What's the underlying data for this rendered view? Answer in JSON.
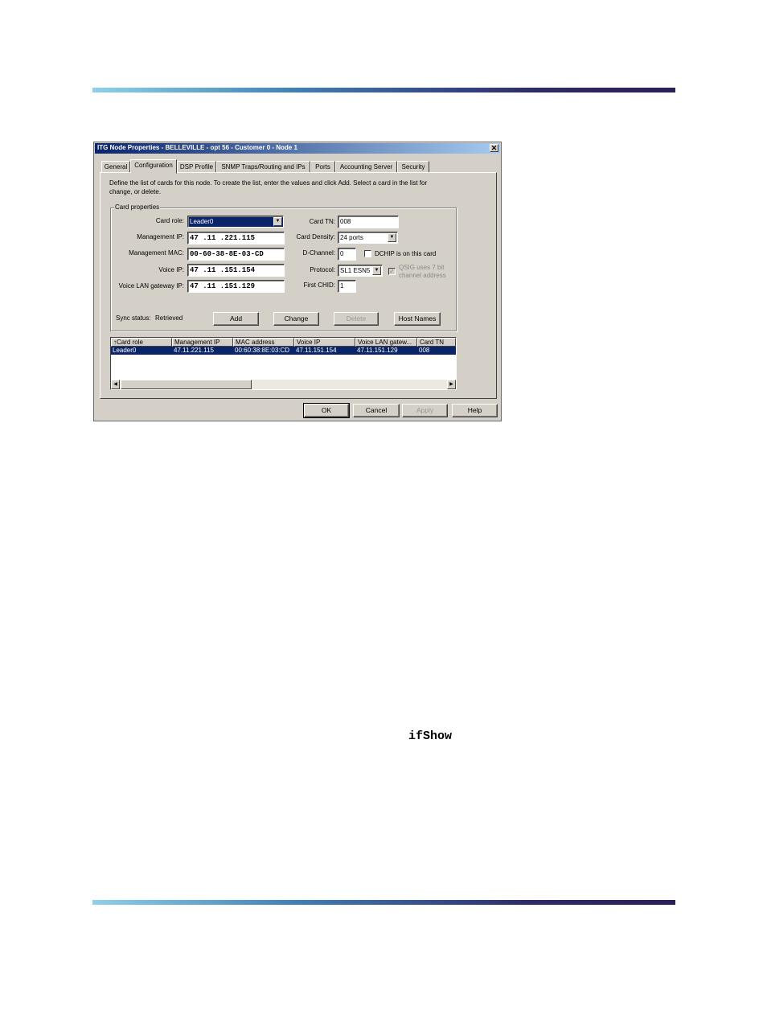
{
  "dialog": {
    "title": "ITG Node Properties - BELLEVILLE - opt 56 - Customer 0 - Node 1",
    "tabs": [
      "General",
      "Configuration",
      "DSP Profile",
      "SNMP Traps/Routing and IPs",
      "Ports",
      "Accounting Server",
      "Security"
    ],
    "active_tab": "Configuration",
    "description_line1": "Define the list of cards for this node.  To create the list, enter the values and click Add.  Select a card in the list for",
    "description_line2": "change, or delete.",
    "card_properties": {
      "group_label": "Card properties",
      "card_role_label": "Card role:",
      "card_role_value": "Leader0",
      "management_ip_label": "Management IP:",
      "management_ip_value": "47 .11 .221.115",
      "management_mac_label": "Management MAC:",
      "management_mac_value": "00-60-38-8E-03-CD",
      "voice_ip_label": "Voice IP:",
      "voice_ip_value": "47 .11 .151.154",
      "voice_gw_label": "Voice LAN gateway IP:",
      "voice_gw_value": "47 .11 .151.129",
      "card_tn_label": "Card TN:",
      "card_tn_value": "008",
      "card_density_label": "Card Density:",
      "card_density_value": "24 ports",
      "dchannel_label": "D-Channel:",
      "dchannel_value": "0",
      "dchip_label": "DCHIP is on this card",
      "protocol_label": "Protocol:",
      "protocol_value": "SL1 ESN5",
      "qsig_line1": "QSIG uses 7 bit",
      "qsig_line2": "channel address",
      "first_chid_label": "First CHID:",
      "first_chid_value": "1",
      "sync_label": "Sync status:",
      "sync_value": "Retrieved",
      "buttons": {
        "add": "Add",
        "change": "Change",
        "delete": "Delete",
        "host_names": "Host Names"
      }
    },
    "list": {
      "columns": [
        "Card role",
        "Management IP",
        "MAC address",
        "Voice IP",
        "Voice LAN gatew...",
        "Card TN"
      ],
      "rows": [
        [
          "Leader0",
          "47.11.221.115",
          "00:60:38:8E:03:CD",
          "47.11.151.154",
          "47.11.151.129",
          "008"
        ]
      ]
    },
    "footer_buttons": {
      "ok": "OK",
      "cancel": "Cancel",
      "apply": "Apply",
      "help": "Help"
    }
  },
  "page": {
    "code_text": "ifShow"
  }
}
